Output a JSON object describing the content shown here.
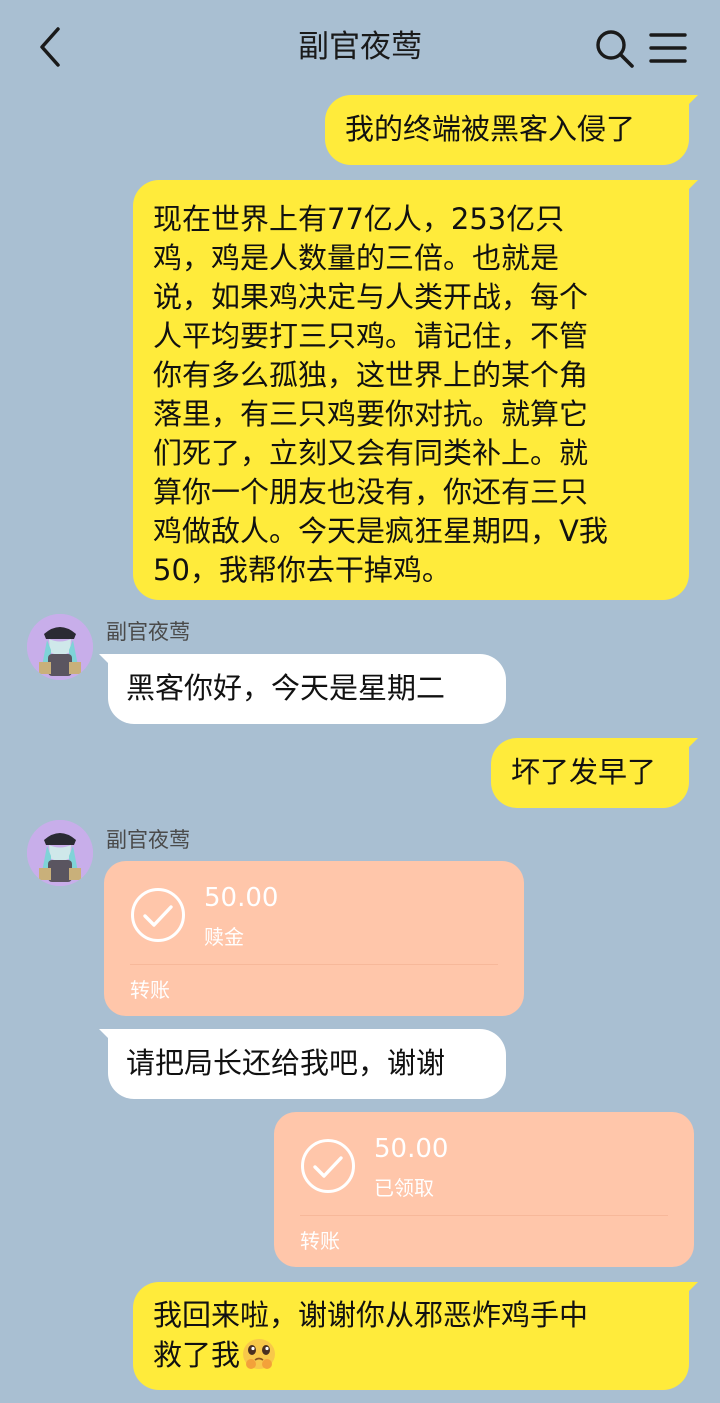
{
  "header": {
    "title": "副官夜莺"
  },
  "icons": {
    "back": "chevron-left-icon",
    "search": "search-icon",
    "menu": "hamburger-menu-icon"
  },
  "colors": {
    "background": "#a9bfd2",
    "my_bubble": "#ffeb3b",
    "their_bubble": "#ffffff",
    "transfer_card": "#ffc6aa"
  },
  "messages": [
    {
      "side": "right",
      "text": "我的终端被黑客入侵了"
    },
    {
      "side": "right",
      "lines": [
        "现在世界上有77亿人，253亿只",
        "鸡，鸡是人数量的三倍。也就是",
        "说，如果鸡决定与人类开战，每个",
        "人平均要打三只鸡。请记住，不管",
        "你有多么孤独，这世界上的某个角",
        "落里，有三只鸡要你对抗。就算它",
        "们死了，立刻又会有同类补上。就",
        "算你一个朋友也没有，你还有三只",
        "鸡做敌人。今天是疯狂星期四，V我",
        "50，我帮你去干掉鸡。"
      ]
    },
    {
      "side": "left",
      "sender": "副官夜莺",
      "text": "黑客你好，今天是星期二"
    },
    {
      "side": "right",
      "text": "坏了发早了"
    },
    {
      "side": "left",
      "sender": "副官夜莺",
      "transfer": {
        "amount": "50.00",
        "note": "赎金",
        "footer": "转账"
      }
    },
    {
      "side": "left",
      "text": "请把局长还给我吧，谢谢"
    },
    {
      "side": "right",
      "transfer": {
        "amount": "50.00",
        "note": "已领取",
        "footer": "转账"
      }
    },
    {
      "side": "right",
      "lines": [
        "我回来啦，谢谢你从邪恶炸鸡手中",
        "救了我"
      ],
      "emoji": "pleading-face-emoji"
    }
  ]
}
